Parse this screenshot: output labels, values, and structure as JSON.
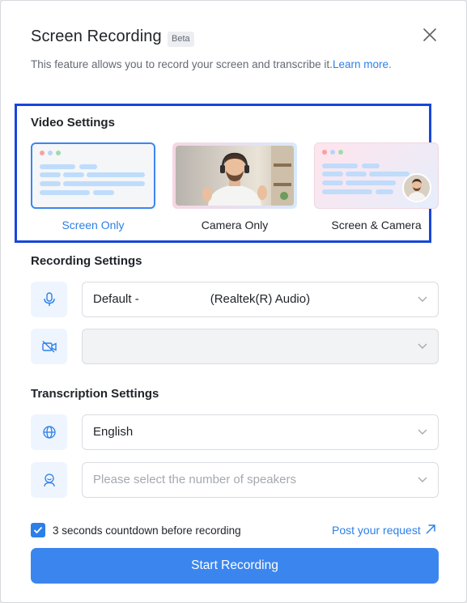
{
  "header": {
    "title": "Screen Recording",
    "badge": "Beta",
    "description": "This feature allows you to record your screen and transcribe it.",
    "learn_more": "Learn more."
  },
  "video_settings": {
    "label": "Video Settings",
    "options": [
      {
        "label": "Screen Only",
        "selected": true
      },
      {
        "label": "Camera Only",
        "selected": false
      },
      {
        "label": "Screen & Camera",
        "selected": false
      }
    ]
  },
  "recording_settings": {
    "label": "Recording Settings",
    "microphone": {
      "value_prefix": "Default -",
      "value_device": "(Realtek(R) Audio)",
      "icon": "microphone-icon"
    },
    "camera": {
      "value": "",
      "icon": "camera-off-icon"
    }
  },
  "transcription_settings": {
    "label": "Transcription Settings",
    "language": {
      "value": "English",
      "icon": "globe-icon"
    },
    "speakers": {
      "placeholder": "Please select the number of speakers",
      "icon": "speaker-icon"
    }
  },
  "footer": {
    "countdown_label": "3 seconds countdown before recording",
    "countdown_checked": true,
    "post_request": "Post your request",
    "start_button": "Start Recording"
  },
  "colors": {
    "accent": "#3b86ee",
    "link": "#2d7fe8",
    "highlight_border": "#1846d8"
  }
}
